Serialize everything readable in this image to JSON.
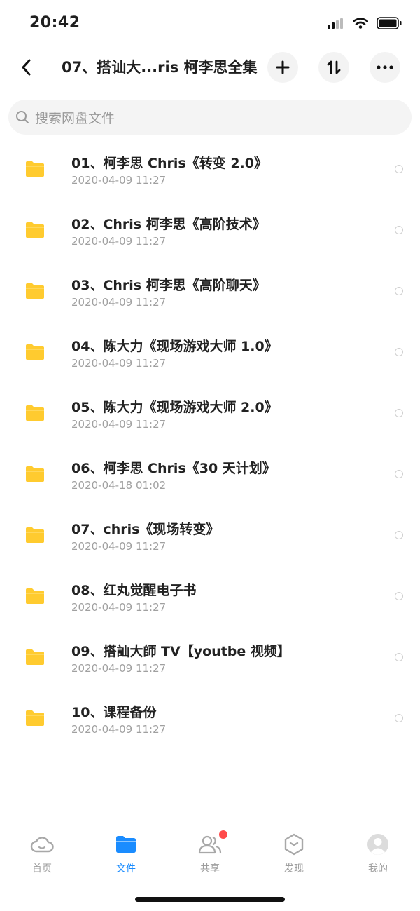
{
  "status_bar": {
    "time": "20:42",
    "icons": [
      "signal-icon",
      "wifi-icon",
      "battery-icon"
    ]
  },
  "nav": {
    "title": "07、搭讪大...ris 柯李思全集",
    "actions": [
      "add-icon",
      "sort-icon",
      "more-icon"
    ]
  },
  "search": {
    "placeholder": "搜索网盘文件"
  },
  "colors": {
    "folder": "#ffcb2f",
    "accent": "#1a8cff",
    "badge": "#ff4a4a"
  },
  "files": [
    {
      "name": "01、柯李思 Chris《转变 2.0》",
      "date": "2020-04-09 11:27"
    },
    {
      "name": "02、Chris 柯李思《高阶技术》",
      "date": "2020-04-09 11:27"
    },
    {
      "name": "03、Chris 柯李思《高阶聊天》",
      "date": "2020-04-09 11:27"
    },
    {
      "name": "04、陈大力《现场游戏大师 1.0》",
      "date": "2020-04-09 11:27"
    },
    {
      "name": "05、陈大力《现场游戏大师 2.0》",
      "date": "2020-04-09 11:27"
    },
    {
      "name": "06、柯李思 Chris《30 天计划》",
      "date": "2020-04-18 01:02"
    },
    {
      "name": "07、chris《现场转变》",
      "date": "2020-04-09 11:27"
    },
    {
      "name": "08、红丸觉醒电子书",
      "date": "2020-04-09 11:27"
    },
    {
      "name": "09、搭訕大師 TV【youtbe 视频】",
      "date": "2020-04-09 11:27"
    },
    {
      "name": "10、课程备份",
      "date": "2020-04-09 11:27"
    }
  ],
  "tabs": [
    {
      "label": "首页",
      "icon": "cloud-icon",
      "active": false
    },
    {
      "label": "文件",
      "icon": "folder-icon",
      "active": true
    },
    {
      "label": "共享",
      "icon": "people-icon",
      "active": false
    },
    {
      "label": "发现",
      "icon": "discover-icon",
      "active": false
    },
    {
      "label": "我的",
      "icon": "avatar-icon",
      "active": false
    }
  ]
}
